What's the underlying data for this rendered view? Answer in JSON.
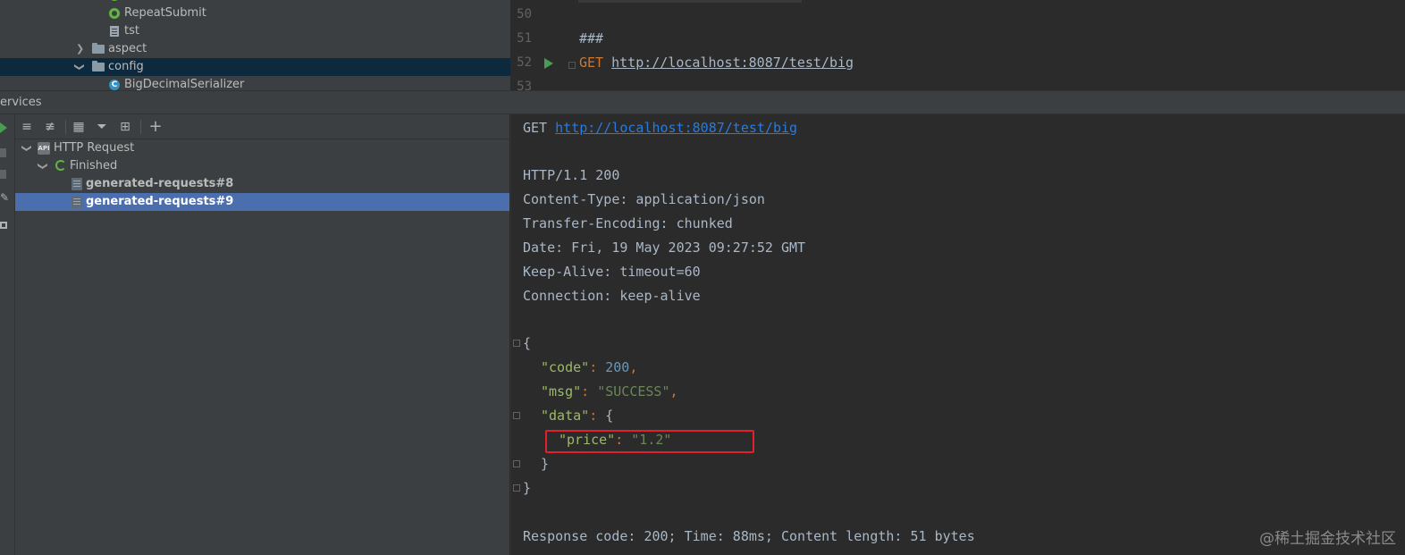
{
  "project_tree": {
    "items": [
      {
        "label": "RepeatSubmit",
        "icon": "spring-bean-icon"
      },
      {
        "label": "tst",
        "icon": "file-icon"
      },
      {
        "label": "aspect",
        "icon": "folder-icon",
        "expanded": false
      },
      {
        "label": "config",
        "icon": "folder-icon",
        "expanded": true
      },
      {
        "label": "BigDecimalSerializer",
        "icon": "class-icon",
        "icon_letter": "C"
      }
    ]
  },
  "editor": {
    "line_numbers": [
      "50",
      "51",
      "52",
      "53"
    ],
    "comment": "###",
    "method": "GET",
    "url": "http://localhost:8087/test/big"
  },
  "services": {
    "title": "ervices",
    "tree": {
      "root": "HTTP Request",
      "group": "Finished",
      "requests": [
        "generated-requests#8",
        "generated-requests#9"
      ],
      "selected_index": 1
    }
  },
  "response": {
    "request_method": "GET",
    "request_url": "http://localhost:8087/test/big",
    "status_line": "HTTP/1.1 200",
    "headers": [
      "Content-Type: application/json",
      "Transfer-Encoding: chunked",
      "Date: Fri, 19 May 2023 09:27:52 GMT",
      "Keep-Alive: timeout=60",
      "Connection: keep-alive"
    ],
    "json": {
      "open_brace": "{",
      "code_key": "\"code\"",
      "code_value": "200",
      "msg_key": "\"msg\"",
      "msg_value": "\"SUCCESS\"",
      "data_key": "\"data\"",
      "price_key": "\"price\"",
      "price_value": "\"1.2\"",
      "inner_close": "}",
      "close_brace": "}"
    },
    "summary": "Response code: 200; Time: 88ms; Content length: 51 bytes"
  },
  "watermark": "@稀土掘金技术社区",
  "colors": {
    "highlight_box": "#e0212b",
    "selection": "#4b6eaf",
    "run_icon": "#499c54"
  }
}
